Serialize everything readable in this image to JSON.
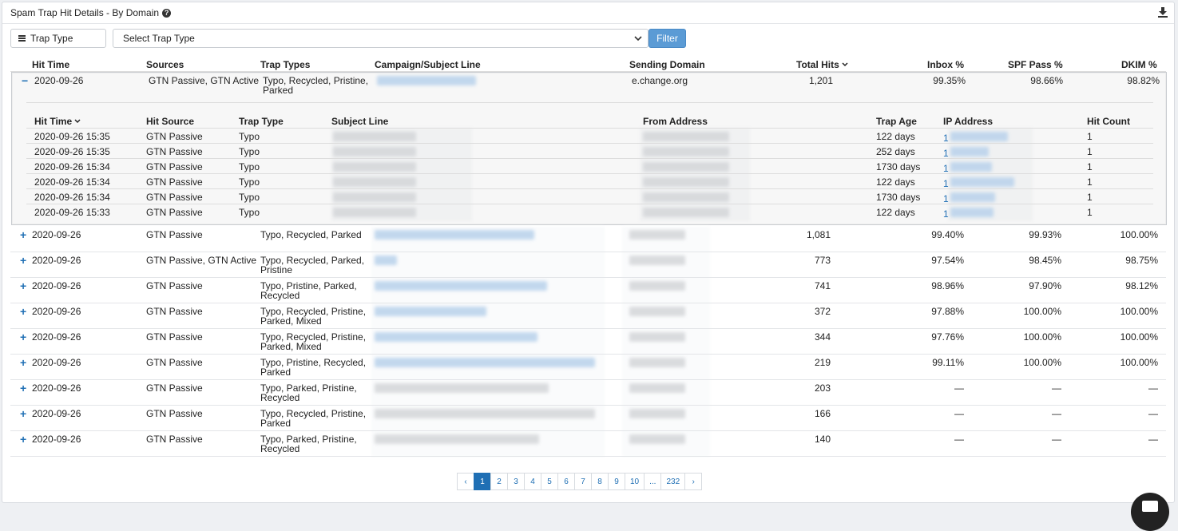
{
  "panel": {
    "title": "Spam Trap Hit Details - By Domain",
    "help": "?"
  },
  "filters": {
    "trap_type_label": "Trap Type",
    "select_placeholder": "Select Trap Type",
    "filter_button": "Filter"
  },
  "table": {
    "headers": [
      "Hit Time",
      "Sources",
      "Trap Types",
      "Campaign/Subject Line",
      "Sending Domain",
      "Total Hits",
      "Inbox %",
      "SPF Pass %",
      "DKIM %"
    ],
    "expanded_row": {
      "toggle": "−",
      "hit_time": "2020-09-26",
      "sources": "GTN Passive, GTN Active",
      "trap_types_1": "Typo, Recycled, Pristine,",
      "trap_types_2": "Parked",
      "sending_domain": "e.change.org",
      "total_hits": "1,201",
      "inbox": "99.35%",
      "spf": "98.66%",
      "dkim": "98.82%"
    },
    "sub_table": {
      "headers": [
        "Hit Time",
        "Hit Source",
        "Trap Type",
        "Subject Line",
        "From Address",
        "Trap Age",
        "IP Address",
        "Hit Count"
      ],
      "rows": [
        {
          "time": "2020-09-26 15:35",
          "source": "GTN Passive",
          "type": "Typo",
          "age": "122 days",
          "ip_prefix": "1",
          "count": "1"
        },
        {
          "time": "2020-09-26 15:35",
          "source": "GTN Passive",
          "type": "Typo",
          "age": "252 days",
          "ip_prefix": "1",
          "count": "1"
        },
        {
          "time": "2020-09-26 15:34",
          "source": "GTN Passive",
          "type": "Typo",
          "age": "1730 days",
          "ip_prefix": "1",
          "count": "1"
        },
        {
          "time": "2020-09-26 15:34",
          "source": "GTN Passive",
          "type": "Typo",
          "age": "122 days",
          "ip_prefix": "1",
          "count": "1"
        },
        {
          "time": "2020-09-26 15:34",
          "source": "GTN Passive",
          "type": "Typo",
          "age": "1730 days",
          "ip_prefix": "1",
          "count": "1"
        },
        {
          "time": "2020-09-26 15:33",
          "source": "GTN Passive",
          "type": "Typo",
          "age": "122 days",
          "ip_prefix": "1",
          "count": "1"
        }
      ]
    },
    "rows": [
      {
        "toggle": "+",
        "hit_time": "2020-09-26",
        "sources": "GTN Passive",
        "types1": "Typo, Recycled, Parked",
        "types2": "",
        "total": "1,081",
        "inbox": "99.40%",
        "spf": "99.93%",
        "dkim": "100.00%"
      },
      {
        "toggle": "+",
        "hit_time": "2020-09-26",
        "sources": "GTN Passive, GTN Active",
        "types1": "Typo, Recycled, Parked,",
        "types2": "Pristine",
        "total": "773",
        "inbox": "97.54%",
        "spf": "98.45%",
        "dkim": "98.75%"
      },
      {
        "toggle": "+",
        "hit_time": "2020-09-26",
        "sources": "GTN Passive",
        "types1": "Typo, Pristine, Parked,",
        "types2": "Recycled",
        "total": "741",
        "inbox": "98.96%",
        "spf": "97.90%",
        "dkim": "98.12%"
      },
      {
        "toggle": "+",
        "hit_time": "2020-09-26",
        "sources": "GTN Passive",
        "types1": "Typo, Recycled, Pristine,",
        "types2": "Parked, Mixed",
        "total": "372",
        "inbox": "97.88%",
        "spf": "100.00%",
        "dkim": "100.00%"
      },
      {
        "toggle": "+",
        "hit_time": "2020-09-26",
        "sources": "GTN Passive",
        "types1": "Typo, Recycled, Pristine,",
        "types2": "Parked, Mixed",
        "total": "344",
        "inbox": "97.76%",
        "spf": "100.00%",
        "dkim": "100.00%"
      },
      {
        "toggle": "+",
        "hit_time": "2020-09-26",
        "sources": "GTN Passive",
        "types1": "Typo, Pristine, Recycled,",
        "types2": "Parked",
        "total": "219",
        "inbox": "99.11%",
        "spf": "100.00%",
        "dkim": "100.00%"
      },
      {
        "toggle": "+",
        "hit_time": "2020-09-26",
        "sources": "GTN Passive",
        "types1": "Typo, Parked, Pristine,",
        "types2": "Recycled",
        "total": "203",
        "inbox": "—",
        "spf": "—",
        "dkim": "—"
      },
      {
        "toggle": "+",
        "hit_time": "2020-09-26",
        "sources": "GTN Passive",
        "types1": "Typo, Recycled, Pristine,",
        "types2": "Parked",
        "total": "166",
        "inbox": "—",
        "spf": "—",
        "dkim": "—"
      },
      {
        "toggle": "+",
        "hit_time": "2020-09-26",
        "sources": "GTN Passive",
        "types1": "Typo, Parked, Pristine,",
        "types2": "Recycled",
        "total": "140",
        "inbox": "—",
        "spf": "—",
        "dkim": "—"
      }
    ]
  },
  "pagination": {
    "prev": "‹",
    "next": "›",
    "pages": [
      "1",
      "2",
      "3",
      "4",
      "5",
      "6",
      "7",
      "8",
      "9",
      "10",
      "...",
      "232"
    ],
    "current": "1"
  }
}
